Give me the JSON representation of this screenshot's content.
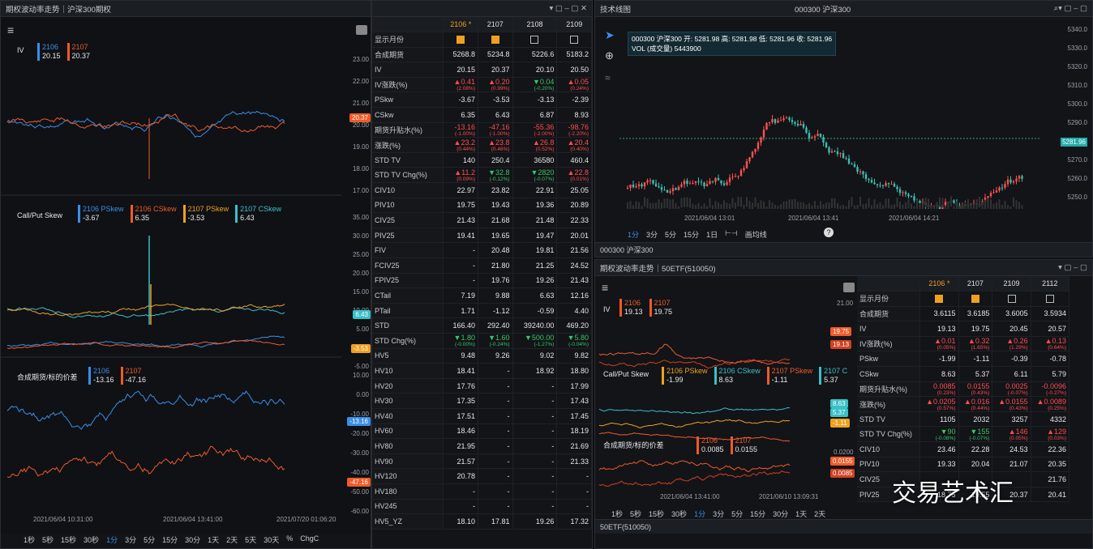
{
  "left_window": {
    "title": "期权波动率走势｜沪深300期权",
    "iv_label": "IV",
    "iv_legend": [
      {
        "name": "2106",
        "value": "20.15",
        "color": "#3a8fe8"
      },
      {
        "name": "2107",
        "value": "20.37",
        "color": "#f05a28"
      }
    ],
    "iv_axis": [
      "23.00",
      "22.00",
      "21.00",
      "20.00",
      "19.00",
      "18.00",
      "17.00"
    ],
    "iv_tag": "20.37",
    "skew_label": "Call/Put Skew",
    "skew_legend": [
      {
        "name": "2106 PSkew",
        "value": "-3.67",
        "color": "#3a8fe8"
      },
      {
        "name": "2106 CSkew",
        "value": "6.35",
        "color": "#f05a28"
      },
      {
        "name": "2107 PSkew",
        "value": "-3.53",
        "color": "#f0a020"
      },
      {
        "name": "2107 CSkew",
        "value": "6.43",
        "color": "#39c0c8"
      }
    ],
    "skew_axis": [
      "35.00",
      "30.00",
      "25.00",
      "20.00",
      "15.00",
      "10.00",
      "5.00",
      "0.00",
      "-5.00"
    ],
    "skew_tags": [
      "6.43",
      "-3.53"
    ],
    "basis_label": "合成期货/标的价差",
    "basis_legend": [
      {
        "name": "2106",
        "value": "-13.16",
        "color": "#3a8fe8"
      },
      {
        "name": "2107",
        "value": "-47.16",
        "color": "#f05a28"
      }
    ],
    "basis_axis": [
      "10.00",
      "0.00",
      "-10.00",
      "-20.00",
      "-30.00",
      "-40.00",
      "-50.00",
      "-60.00"
    ],
    "basis_tags": [
      "-13.16",
      "-47.16"
    ],
    "dates": [
      "2021/06/04 10:31:00",
      "2021/06/04 13:41:00",
      "2021/07/20 01:06:20"
    ],
    "timeframes": [
      "1秒",
      "5秒",
      "15秒",
      "30秒",
      "1分",
      "3分",
      "5分",
      "15分",
      "30分",
      "1天",
      "2天",
      "5天",
      "30天",
      "%",
      "ChgC"
    ]
  },
  "table_window": {
    "headers": [
      "",
      "2106 *",
      "2107",
      "2108",
      "2109"
    ],
    "rows": [
      {
        "label": "显示月份",
        "cells": [
          "on",
          "on",
          "off",
          "off"
        ]
      },
      {
        "label": "合成期货",
        "cells": [
          "5268.8",
          "5234.8",
          "5226.6",
          "5183.2"
        ]
      },
      {
        "label": "IV",
        "cells": [
          "20.15",
          "20.37",
          "20.10",
          "20.50"
        ]
      },
      {
        "label": "IV涨跌(%)",
        "cells": [
          "▲0.41|(2.08%)",
          "▲0.20|(0.99%)",
          "▼0.04|(-0.20%)",
          "▲0.05|(0.24%)"
        ]
      },
      {
        "label": "PSkw",
        "cells": [
          "-3.67",
          "-3.53",
          "-3.13",
          "-2.39"
        ]
      },
      {
        "label": "CSkw",
        "cells": [
          "6.35",
          "6.43",
          "6.87",
          "8.93"
        ]
      },
      {
        "label": "期货升贴水(%)",
        "cells": [
          "-13.16|(-1.00%)",
          "-47.16|(-1.00%)",
          "-55.36|(-2.00%)",
          "-98.76|(-2.20%)"
        ]
      },
      {
        "label": "涨跌(%)",
        "cells": [
          "▲23.2|(0.44%)",
          "▲23.8|(0.46%)",
          "▲26.8|(0.52%)",
          "▲20.4|(0.40%)"
        ]
      },
      {
        "label": "STD TV",
        "cells": [
          "140",
          "250.4",
          "36580",
          "460.4"
        ]
      },
      {
        "label": "STD TV Chg(%)",
        "cells": [
          "▲11.2|(0.09%)",
          "▼32.8|(-0.12%)",
          "▼2820|(-0.07%)",
          "▲22.8|(0.01%)"
        ]
      },
      {
        "label": "CIV10",
        "cells": [
          "22.97",
          "23.82",
          "22.91",
          "25.05"
        ]
      },
      {
        "label": "PIV10",
        "cells": [
          "19.75",
          "19.43",
          "19.36",
          "20.89"
        ]
      },
      {
        "label": "CIV25",
        "cells": [
          "21.43",
          "21.68",
          "21.48",
          "22.33"
        ]
      },
      {
        "label": "PIV25",
        "cells": [
          "19.41",
          "19.65",
          "19.47",
          "20.01"
        ]
      },
      {
        "label": "FIV",
        "cells": [
          "-",
          "20.48",
          "19.81",
          "21.56"
        ]
      },
      {
        "label": "FCIV25",
        "cells": [
          "-",
          "21.80",
          "21.25",
          "24.52"
        ]
      },
      {
        "label": "FPIV25",
        "cells": [
          "-",
          "19.76",
          "19.26",
          "21.43"
        ]
      },
      {
        "label": "CTail",
        "cells": [
          "7.19",
          "9.88",
          "6.63",
          "12.16"
        ]
      },
      {
        "label": "PTail",
        "cells": [
          "1.71",
          "-1.12",
          "-0.59",
          "4.40"
        ]
      },
      {
        "label": "STD",
        "cells": [
          "166.40",
          "292.40",
          "39240.00",
          "469.20"
        ]
      },
      {
        "label": "STD Chg(%)",
        "cells": [
          "▼1.80|(-0.00%)",
          "▼1.60|(-0.24%)",
          "▼500.00|(-1.27%)",
          "▼5.80|(-0.04%)"
        ]
      },
      {
        "label": "HV5",
        "cells": [
          "9.48",
          "9.26",
          "9.02",
          "9.82"
        ]
      },
      {
        "label": "HV10",
        "cells": [
          "18.41",
          "-",
          "18.92",
          "18.80"
        ]
      },
      {
        "label": "HV20",
        "cells": [
          "17.76",
          "-",
          "-",
          "17.99"
        ]
      },
      {
        "label": "HV30",
        "cells": [
          "17.35",
          "-",
          "-",
          "17.43"
        ]
      },
      {
        "label": "HV40",
        "cells": [
          "17.51",
          "-",
          "-",
          "17.45"
        ]
      },
      {
        "label": "HV60",
        "cells": [
          "18.46",
          "-",
          "-",
          "18.19"
        ]
      },
      {
        "label": "HV80",
        "cells": [
          "21.95",
          "-",
          "-",
          "21.69"
        ]
      },
      {
        "label": "HV90",
        "cells": [
          "21.57",
          "-",
          "-",
          "21.33"
        ]
      },
      {
        "label": "HV120",
        "cells": [
          "20.78",
          "-",
          "-",
          "-"
        ]
      },
      {
        "label": "HV180",
        "cells": [
          "-",
          "-",
          "-",
          "-"
        ]
      },
      {
        "label": "HV245",
        "cells": [
          "-",
          "-",
          "-",
          "-"
        ]
      },
      {
        "label": "HV5_YZ",
        "cells": [
          "18.10",
          "17.81",
          "19.26",
          "17.32"
        ]
      }
    ]
  },
  "kline_window": {
    "title": "技术线图",
    "symbol": "000300 沪深300",
    "ohlc": "000300 沪深300  开: 5281.98 高: 5281.98 低: 5281.96 收: 5281.96",
    "vol": "VOL (成交量)  5443900",
    "axis": [
      "5340.0",
      "5330.0",
      "5320.0",
      "5310.0",
      "5300.0",
      "5290.0",
      "5281.96",
      "5270.0",
      "5260.0",
      "5250.0"
    ],
    "dates": [
      "2021/06/04 13:01",
      "2021/06/04 13:41",
      "2021/06/04 14:21"
    ],
    "timeframes": [
      "1分",
      "3分",
      "5分",
      "15分",
      "1日",
      "⊢⊣",
      "画均线"
    ],
    "status": "000300 沪深300"
  },
  "etf_window": {
    "title": "期权波动率走势｜50ETF(510050)",
    "iv_legend": [
      {
        "name": "2106",
        "value": "19.13",
        "color": "#f05a28"
      },
      {
        "name": "2107",
        "value": "19.75",
        "color": "#f05a28"
      }
    ],
    "iv_axis_top": "21.00",
    "iv_tags": [
      "19.75",
      "19.13"
    ],
    "skew_label": "Call/Put Skew",
    "skew_legend": [
      {
        "name": "2106 PSkew",
        "value": "-1.99",
        "color": "#f0a020"
      },
      {
        "name": "2106 CSkew",
        "value": "8.63",
        "color": "#39c0c8"
      },
      {
        "name": "2107 PSkew",
        "value": "-1.11",
        "color": "#f05a28"
      },
      {
        "name": "2107 C",
        "value": "5.37",
        "color": "#39c0c8"
      }
    ],
    "skew_tags": [
      "8.63",
      "5.37",
      "-1.11"
    ],
    "basis_label": "合成期货/标的价差",
    "basis_legend": [
      {
        "name": "2106",
        "value": "0.0085",
        "color": "#f05a28"
      },
      {
        "name": "2107",
        "value": "0.0155",
        "color": "#f05a28"
      }
    ],
    "basis_axis": "0.0200",
    "basis_tags": [
      "0.0155",
      "0.0085"
    ],
    "dates": [
      "2021/06/04 13:41:00",
      "2021/06/10 13:09:31"
    ],
    "timeframes": [
      "1秒",
      "5秒",
      "15秒",
      "30秒",
      "1分",
      "3分",
      "5分",
      "15分",
      "30分",
      "1天",
      "2天"
    ],
    "status": "50ETF(510050)",
    "headers": [
      "",
      "2106 *",
      "2107",
      "2109",
      "2112"
    ],
    "rows": [
      {
        "label": "显示月份",
        "cells": [
          "on",
          "on",
          "off",
          "off"
        ]
      },
      {
        "label": "合成期货",
        "cells": [
          "3.6115",
          "3.6185",
          "3.6005",
          "3.5934"
        ]
      },
      {
        "label": "IV",
        "cells": [
          "19.13",
          "19.75",
          "20.45",
          "20.57"
        ]
      },
      {
        "label": "IV涨跌(%)",
        "cells": [
          "▲0.01|(0.05%)",
          "▲0.32|(1.65%)",
          "▲0.26|(1.29%)",
          "▲0.13|(0.64%)"
        ]
      },
      {
        "label": "PSkw",
        "cells": [
          "-1.99",
          "-1.11",
          "-0.39",
          "-0.78"
        ]
      },
      {
        "label": "CSkw",
        "cells": [
          "8.63",
          "5.37",
          "6.11",
          "5.79"
        ]
      },
      {
        "label": "期货升贴水(%)",
        "cells": [
          "0.0085|(0.23%)",
          "0.0155|(0.43%)",
          "0.0025|(-0.07%)",
          "-0.0096|(-0.27%)"
        ]
      },
      {
        "label": "涨跌(%)",
        "cells": [
          "▲0.0205|(0.57%)",
          "▲0.016|(0.44%)",
          "▲0.0155|(0.43%)",
          "▲0.0089|(0.25%)"
        ]
      },
      {
        "label": "STD TV",
        "cells": [
          "1105",
          "2032",
          "3257",
          "4332"
        ]
      },
      {
        "label": "STD TV Chg(%)",
        "cells": [
          "▼90|(-0.08%)",
          "▼155|(-0.07%)",
          "▲146|(0.05%)",
          "▲129|(0.03%)"
        ]
      },
      {
        "label": "CIV10",
        "cells": [
          "23.46",
          "22.28",
          "24.53",
          "22.36"
        ]
      },
      {
        "label": "PIV10",
        "cells": [
          "19.33",
          "20.04",
          "21.07",
          "20.35"
        ]
      },
      {
        "label": "CIV25",
        "cells": [
          "",
          "",
          "",
          "21.76"
        ]
      },
      {
        "label": "PIV25",
        "cells": [
          "18.75",
          "19.55",
          "20.37",
          "20.41"
        ]
      }
    ]
  },
  "watermark": "交易艺术汇"
}
